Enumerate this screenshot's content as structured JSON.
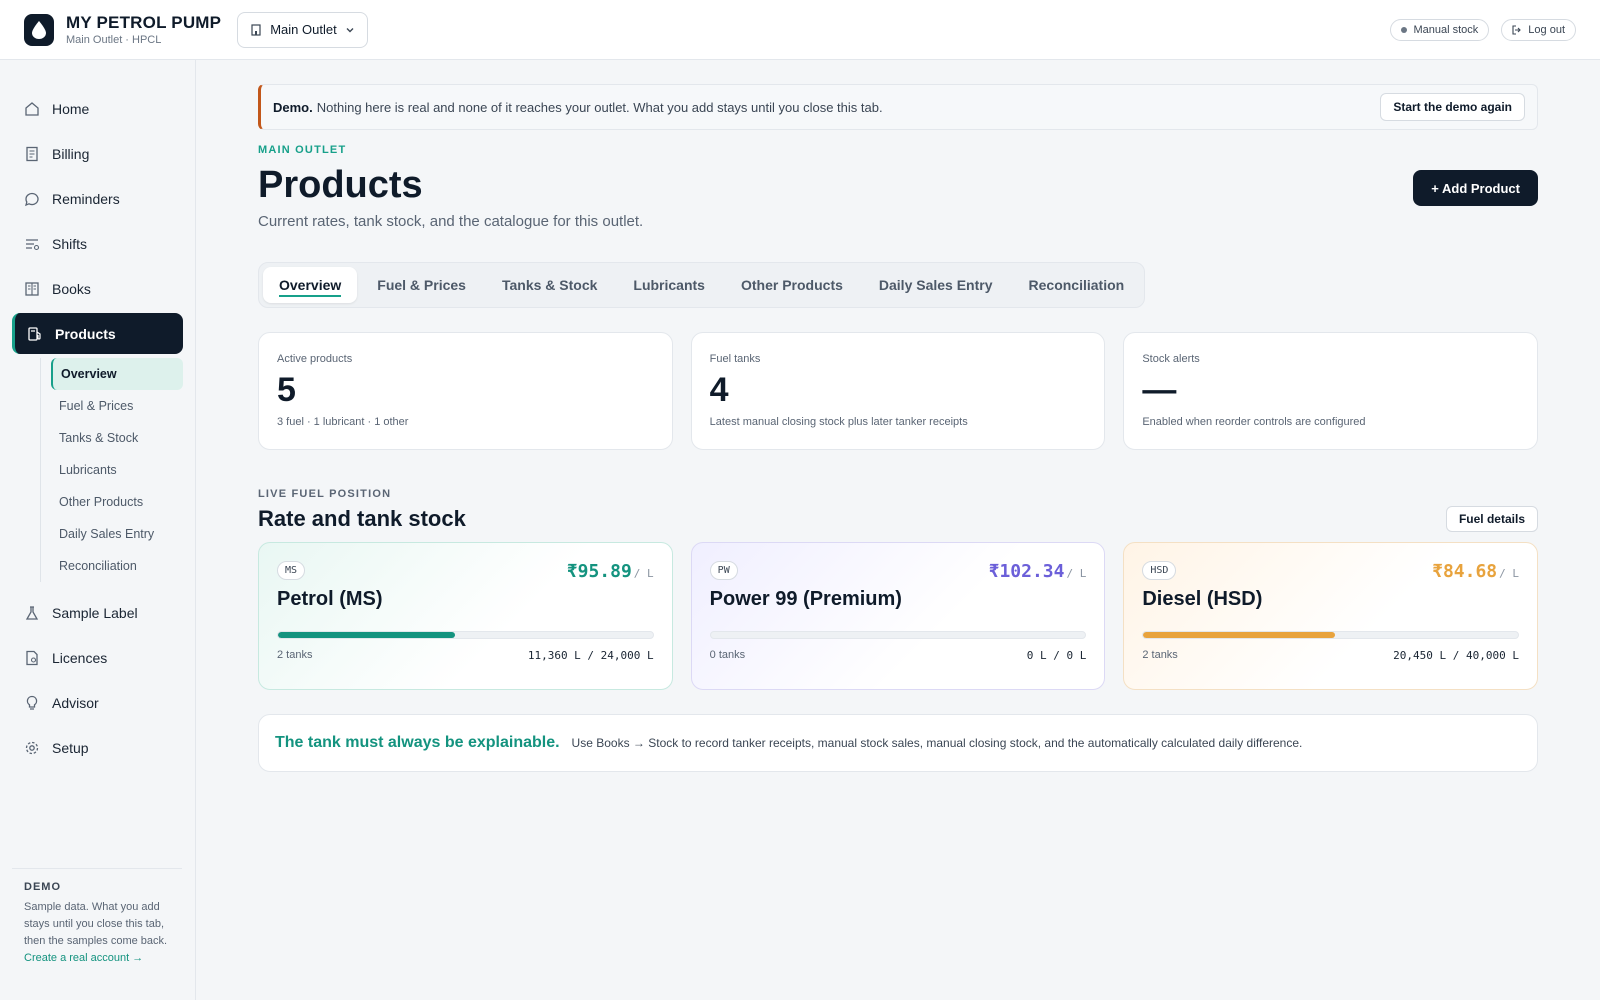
{
  "header": {
    "app_title": "MY PETROL PUMP",
    "app_subtitle": "Main Outlet · HPCL",
    "outlet_selected": "Main Outlet",
    "manual_stock_label": "Manual stock",
    "logout_label": "Log out"
  },
  "sidebar": {
    "items": [
      {
        "label": "Home",
        "icon": "home-icon"
      },
      {
        "label": "Billing",
        "icon": "receipt-icon"
      },
      {
        "label": "Reminders",
        "icon": "chat-icon"
      },
      {
        "label": "Shifts",
        "icon": "shifts-icon"
      },
      {
        "label": "Books",
        "icon": "book-icon"
      },
      {
        "label": "Products",
        "icon": "fuel-pump-icon",
        "active": true
      },
      {
        "label": "Sample Label",
        "icon": "flask-icon"
      },
      {
        "label": "Licences",
        "icon": "document-icon"
      },
      {
        "label": "Advisor",
        "icon": "lightbulb-icon"
      },
      {
        "label": "Setup",
        "icon": "gear-icon"
      }
    ],
    "sub_items": [
      "Overview",
      "Fuel & Prices",
      "Tanks & Stock",
      "Lubricants",
      "Other Products",
      "Daily Sales Entry",
      "Reconciliation"
    ],
    "demo": {
      "heading": "DEMO",
      "text": "Sample data. What you add stays until you close this tab, then the samples come back.",
      "link": "Create a real account →"
    }
  },
  "banner": {
    "strong": "Demo.",
    "text": "Nothing here is real and none of it reaches your outlet. What you add stays until you close this tab.",
    "button": "Start the demo again"
  },
  "page": {
    "eyebrow": "MAIN OUTLET",
    "title": "Products",
    "description": "Current rates, tank stock, and the catalogue for this outlet.",
    "add_button": "+ Add Product"
  },
  "tabs": [
    "Overview",
    "Fuel & Prices",
    "Tanks & Stock",
    "Lubricants",
    "Other Products",
    "Daily Sales Entry",
    "Reconciliation"
  ],
  "stats": [
    {
      "label": "Active products",
      "value": "5",
      "note": "3 fuel · 1 lubricant · 1 other"
    },
    {
      "label": "Fuel tanks",
      "value": "4",
      "note": "Latest manual closing stock plus later tanker receipts"
    },
    {
      "label": "Stock alerts",
      "value": "—",
      "note": "Enabled when reorder controls are configured"
    }
  ],
  "fuel_section": {
    "eyebrow": "LIVE FUEL POSITION",
    "title": "Rate and tank stock",
    "button": "Fuel details"
  },
  "fuels": [
    {
      "code": "MS",
      "rate": "₹95.89",
      "unit": "/ L",
      "name": "Petrol (MS)",
      "tanks": "2 tanks",
      "stock": "11,360 L / 24,000 L",
      "fill": 0.473,
      "color": "#14937f"
    },
    {
      "code": "PW",
      "rate": "₹102.34",
      "unit": "/ L",
      "name": "Power 99 (Premium)",
      "tanks": "0 tanks",
      "stock": "0 L / 0 L",
      "fill": 0,
      "color": "#6b5fd9"
    },
    {
      "code": "HSD",
      "rate": "₹84.68",
      "unit": "/ L",
      "name": "Diesel (HSD)",
      "tanks": "2 tanks",
      "stock": "20,450 L / 40,000 L",
      "fill": 0.511,
      "color": "#e8a33d"
    }
  ],
  "note": {
    "strong": "The tank must always be explainable.",
    "text": "Use Books → Stock to record tanker receipts, manual stock sales, manual closing stock, and the automatically calculated daily difference."
  }
}
